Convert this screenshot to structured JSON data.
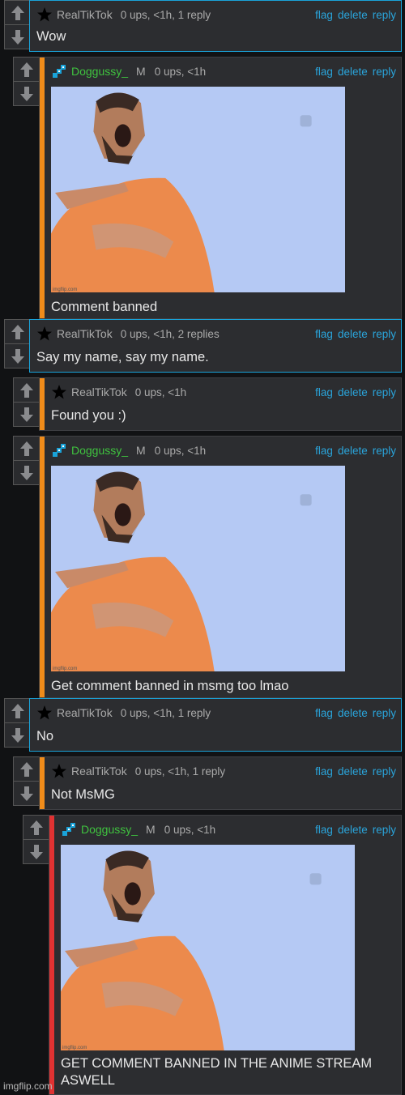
{
  "actions": {
    "flag": "flag",
    "delete": "delete",
    "reply": "reply"
  },
  "comments": [
    {
      "user": "RealTikTok",
      "gender": "",
      "info": "0 ups, <1h, 1 reply",
      "text": "Wow"
    },
    {
      "user": "Doggussy_",
      "gender": "M",
      "info": "0 ups, <1h",
      "text": "Comment banned",
      "image_watermark": "imgflip.com"
    },
    {
      "user": "RealTikTok",
      "gender": "",
      "info": "0 ups, <1h, 2 replies",
      "text": "Say my name, say my name."
    },
    {
      "user": "RealTikTok",
      "gender": "",
      "info": "0 ups, <1h",
      "text": "Found you :)"
    },
    {
      "user": "Doggussy_",
      "gender": "M",
      "info": "0 ups, <1h",
      "text": "Get comment banned in msmg too lmao",
      "image_watermark": "imgflip.com"
    },
    {
      "user": "RealTikTok",
      "gender": "",
      "info": "0 ups, <1h, 1 reply",
      "text": "No"
    },
    {
      "user": "RealTikTok",
      "gender": "",
      "info": "0 ups, <1h, 1 reply",
      "text": "Not MsMG"
    },
    {
      "user": "Doggussy_",
      "gender": "M",
      "info": "0 ups, <1h",
      "text": "GET COMMENT BANNED IN THE ANIME STREAM ASWELL",
      "image_watermark": "imgflip.com"
    }
  ],
  "footer_watermark": "imgflip.com",
  "colors": {
    "accent_blue": "#1aa3d9",
    "orange": "#f08c1a",
    "red": "#e03232",
    "username_green": "#3fc23f",
    "link": "#2aa4da"
  },
  "icons": {
    "star": "star-icon",
    "pixel_avatar": "pixel-avatar-icon",
    "upvote": "upvote-arrow-icon",
    "downvote": "downvote-arrow-icon"
  }
}
